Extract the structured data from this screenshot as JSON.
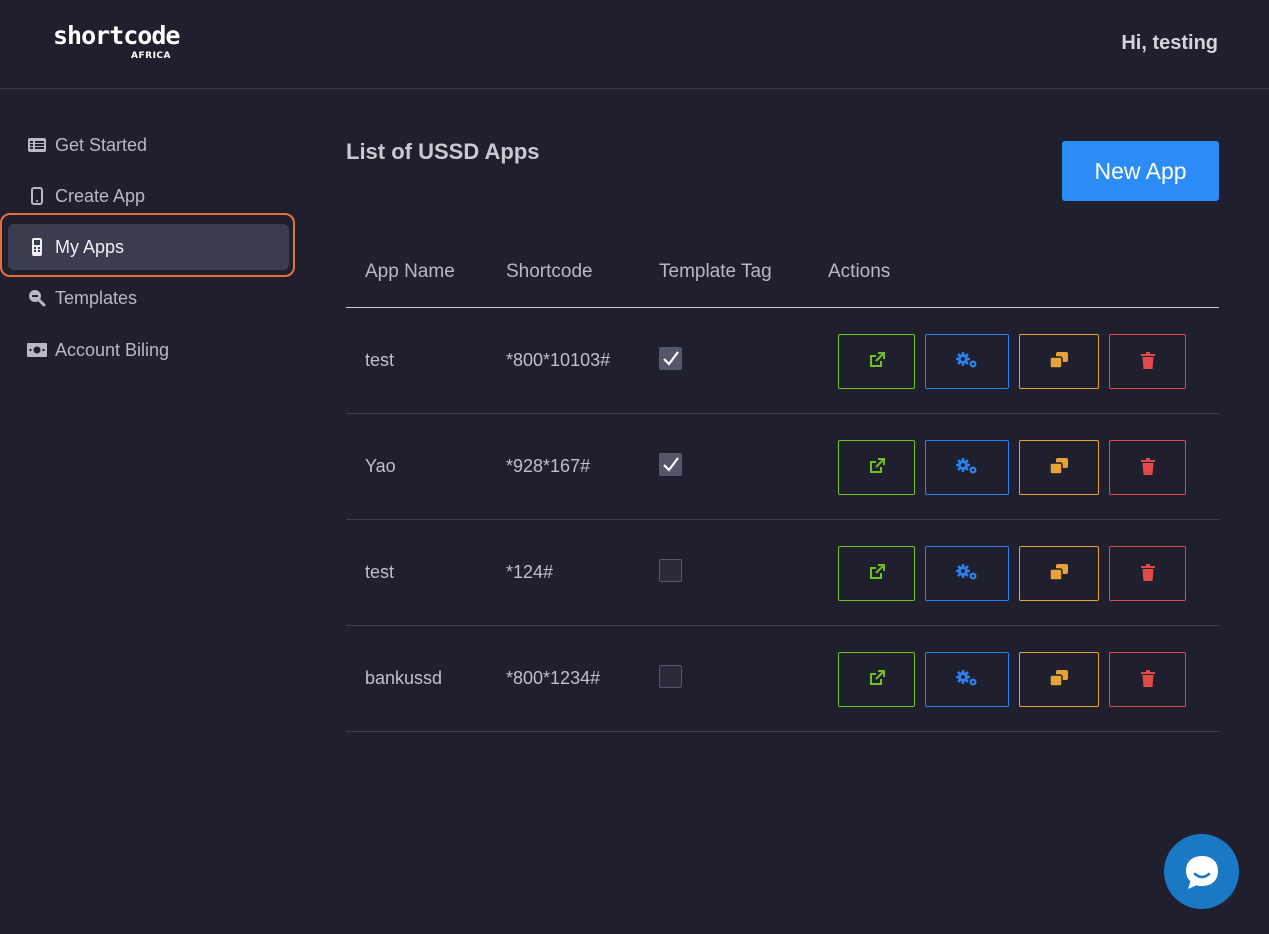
{
  "brand": {
    "name": "shortcode",
    "sub": "AFRICA"
  },
  "header": {
    "greeting": "Hi, testing"
  },
  "sidebar": {
    "items": [
      {
        "label": "Get Started",
        "icon": "list-icon",
        "active": false
      },
      {
        "label": "Create App",
        "icon": "mobile-icon",
        "active": false
      },
      {
        "label": "My Apps",
        "icon": "mobile-apps-icon",
        "active": true
      },
      {
        "label": "Templates",
        "icon": "search-icon",
        "active": false
      },
      {
        "label": "Account Biling",
        "icon": "money-icon",
        "active": false
      }
    ]
  },
  "main": {
    "title": "List of USSD Apps",
    "new_app_label": "New App",
    "columns": [
      "App Name",
      "Shortcode",
      "Template Tag",
      "Actions"
    ],
    "rows": [
      {
        "name": "test",
        "shortcode": "*800*10103#",
        "template": true
      },
      {
        "name": "Yao",
        "shortcode": "*928*167#",
        "template": true
      },
      {
        "name": "test",
        "shortcode": "*124#",
        "template": false
      },
      {
        "name": "bankussd",
        "shortcode": "*800*1234#",
        "template": false
      }
    ],
    "action_icons": [
      "external-link-icon",
      "cogs-icon",
      "copy-icon",
      "trash-icon"
    ]
  },
  "colors": {
    "background": "#1f1f2e",
    "primary": "#2b8cf6",
    "active_ring": "#e8703a",
    "open": "#6fc21f",
    "settings": "#2b82f0",
    "copy": "#e8a23a",
    "delete": "#e24a4a",
    "chat": "#1a78c4"
  }
}
